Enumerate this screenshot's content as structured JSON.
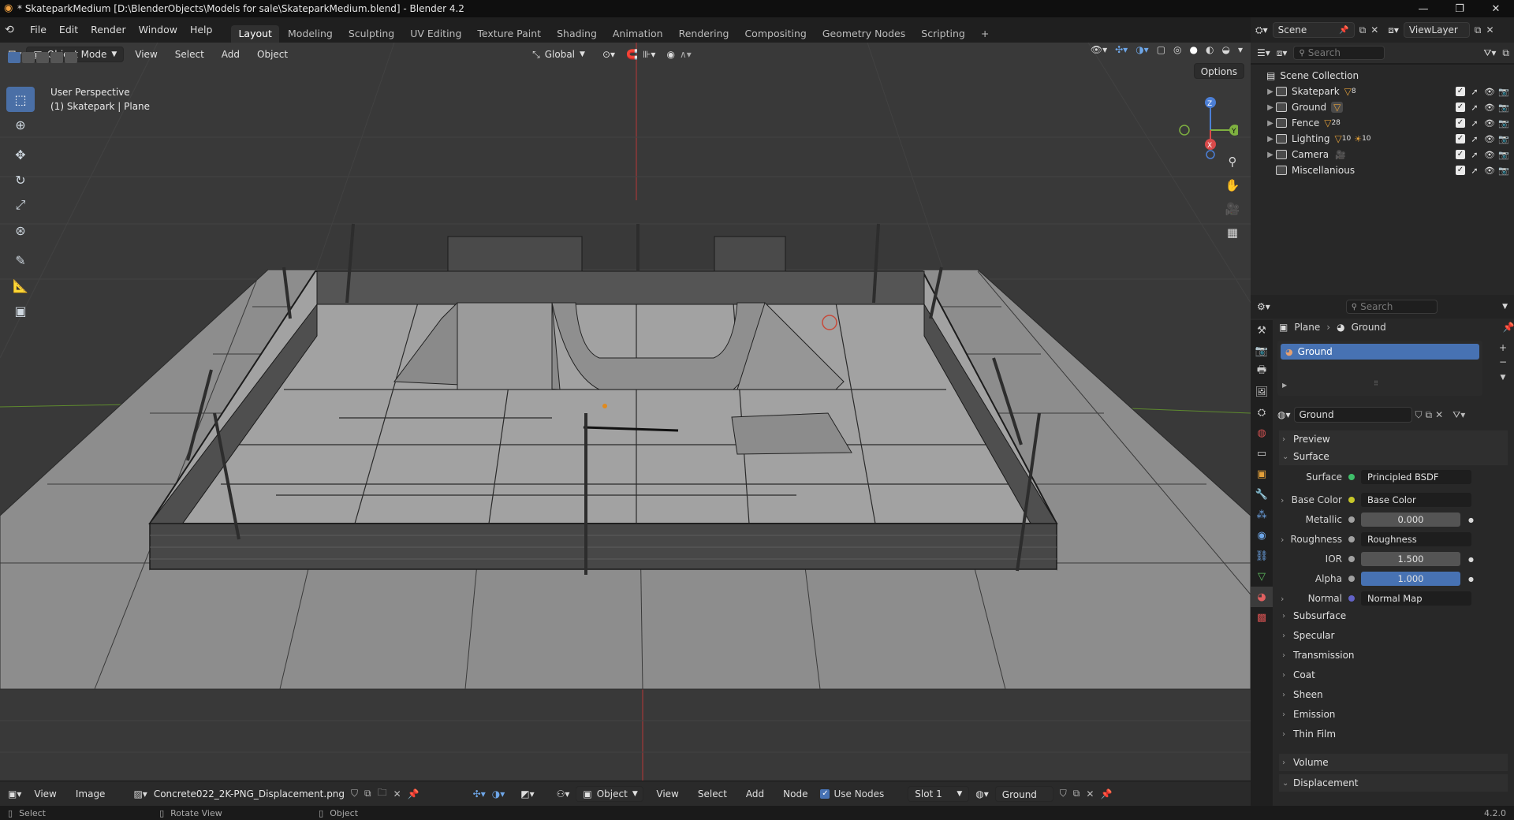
{
  "window": {
    "title": "* SkateparkMedium [D:\\BlenderObjects\\Models for sale\\SkateparkMedium.blend] - Blender 4.2",
    "controls": [
      "—",
      "❐",
      "✕"
    ]
  },
  "menu": {
    "items": [
      "File",
      "Edit",
      "Render",
      "Window",
      "Help"
    ],
    "workspaces": [
      "Layout",
      "Modeling",
      "Sculpting",
      "UV Editing",
      "Texture Paint",
      "Shading",
      "Animation",
      "Rendering",
      "Compositing",
      "Geometry Nodes",
      "Scripting"
    ],
    "active_workspace": "Layout",
    "add_tab": "+",
    "scene": "Scene",
    "view_layer": "ViewLayer"
  },
  "viewport": {
    "mode": "Object Mode",
    "menus": [
      "View",
      "Select",
      "Add",
      "Object"
    ],
    "transform_orientation": "Global",
    "options_label": "Options",
    "info_line1": "User Perspective",
    "info_line2": "(1) Skatepark | Plane",
    "gizmo": {
      "z": "Z",
      "y": "Y",
      "x": "X"
    }
  },
  "outliner": {
    "search_placeholder": "Search",
    "root": "Scene Collection",
    "items": [
      {
        "name": "Skatepark",
        "badge": "8"
      },
      {
        "name": "Ground",
        "badge": ""
      },
      {
        "name": "Fence",
        "badge": "28"
      },
      {
        "name": "Lighting",
        "badge": "10",
        "badge2": "10"
      },
      {
        "name": "Camera",
        "badge": ""
      },
      {
        "name": "Miscellanious",
        "badge": ""
      }
    ]
  },
  "properties": {
    "search_placeholder": "Search",
    "breadcrumb_object": "Plane",
    "breadcrumb_material": "Ground",
    "slot_name": "Ground",
    "material_name": "Ground",
    "sections": {
      "preview": "Preview",
      "surface": "Surface",
      "subsurface": "Subsurface",
      "specular": "Specular",
      "transmission": "Transmission",
      "coat": "Coat",
      "sheen": "Sheen",
      "emission": "Emission",
      "thin_film": "Thin Film",
      "volume": "Volume",
      "displacement": "Displacement"
    },
    "fields": {
      "surface_label": "Surface",
      "surface_value": "Principled BSDF",
      "base_color_label": "Base Color",
      "base_color_value": "Base Color",
      "metallic_label": "Metallic",
      "metallic_value": "0.000",
      "roughness_label": "Roughness",
      "roughness_value": "Roughness",
      "ior_label": "IOR",
      "ior_value": "1.500",
      "alpha_label": "Alpha",
      "alpha_value": "1.000",
      "normal_label": "Normal",
      "normal_value": "Normal Map"
    }
  },
  "bottom": {
    "view": "View",
    "image": "Image",
    "image_file": "Concrete022_2K-PNG_Displacement.png",
    "object": "Object",
    "menus": [
      "View",
      "Select",
      "Add",
      "Node"
    ],
    "use_nodes": "Use Nodes",
    "slot": "Slot 1",
    "material": "Ground"
  },
  "status": {
    "select": "Select",
    "rotate": "Rotate View",
    "object": "Object",
    "version": "4.2.0"
  }
}
